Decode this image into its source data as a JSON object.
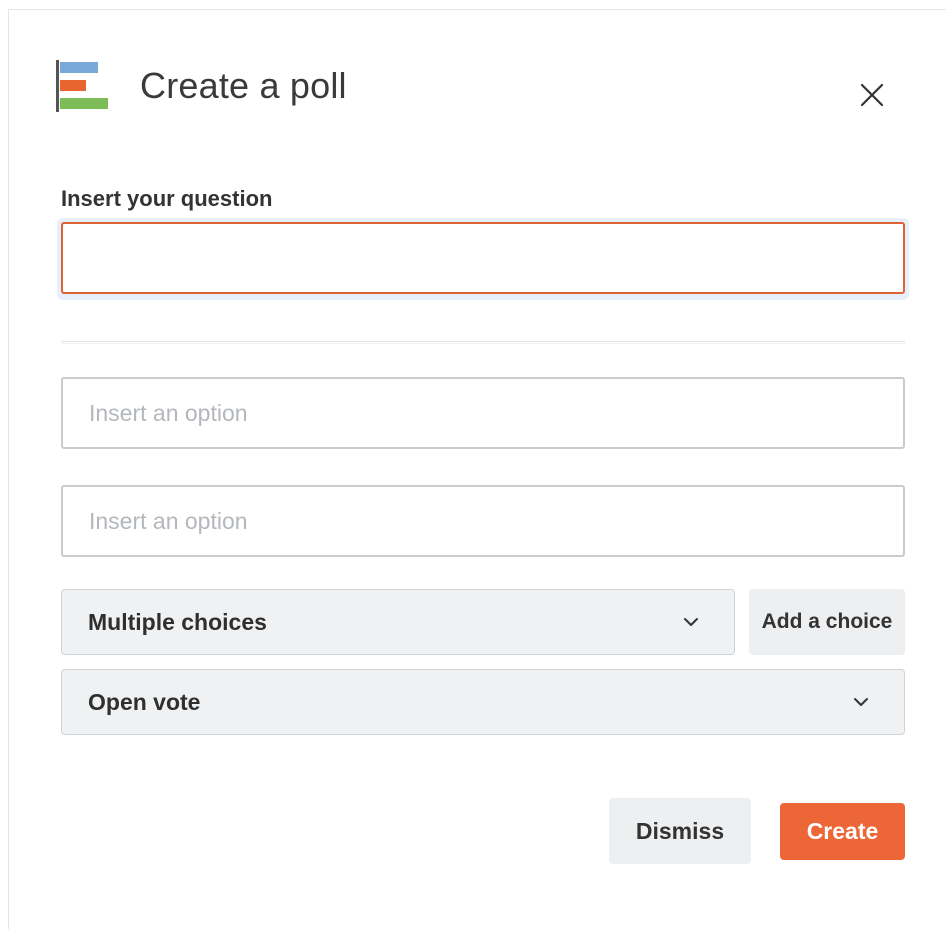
{
  "dialog": {
    "title": "Create a poll",
    "icon": "poll-chart-icon",
    "close_icon": "close-icon"
  },
  "question": {
    "label": "Insert your question",
    "value": "",
    "placeholder": ""
  },
  "options": [
    {
      "value": "",
      "placeholder": "Insert an option"
    },
    {
      "value": "",
      "placeholder": "Insert an option"
    }
  ],
  "choice_type": {
    "selected": "Multiple choices",
    "icon": "chevron-down-icon"
  },
  "add_choice": {
    "label": "Add a choice"
  },
  "vote_type": {
    "selected": "Open vote",
    "icon": "chevron-down-icon"
  },
  "footer": {
    "dismiss_label": "Dismiss",
    "create_label": "Create"
  },
  "colors": {
    "accent": "#ec6638",
    "focus_border": "#dd6234",
    "icon_blue": "#7aa9d9",
    "icon_orange": "#e8652f",
    "icon_green": "#7cbd57"
  }
}
